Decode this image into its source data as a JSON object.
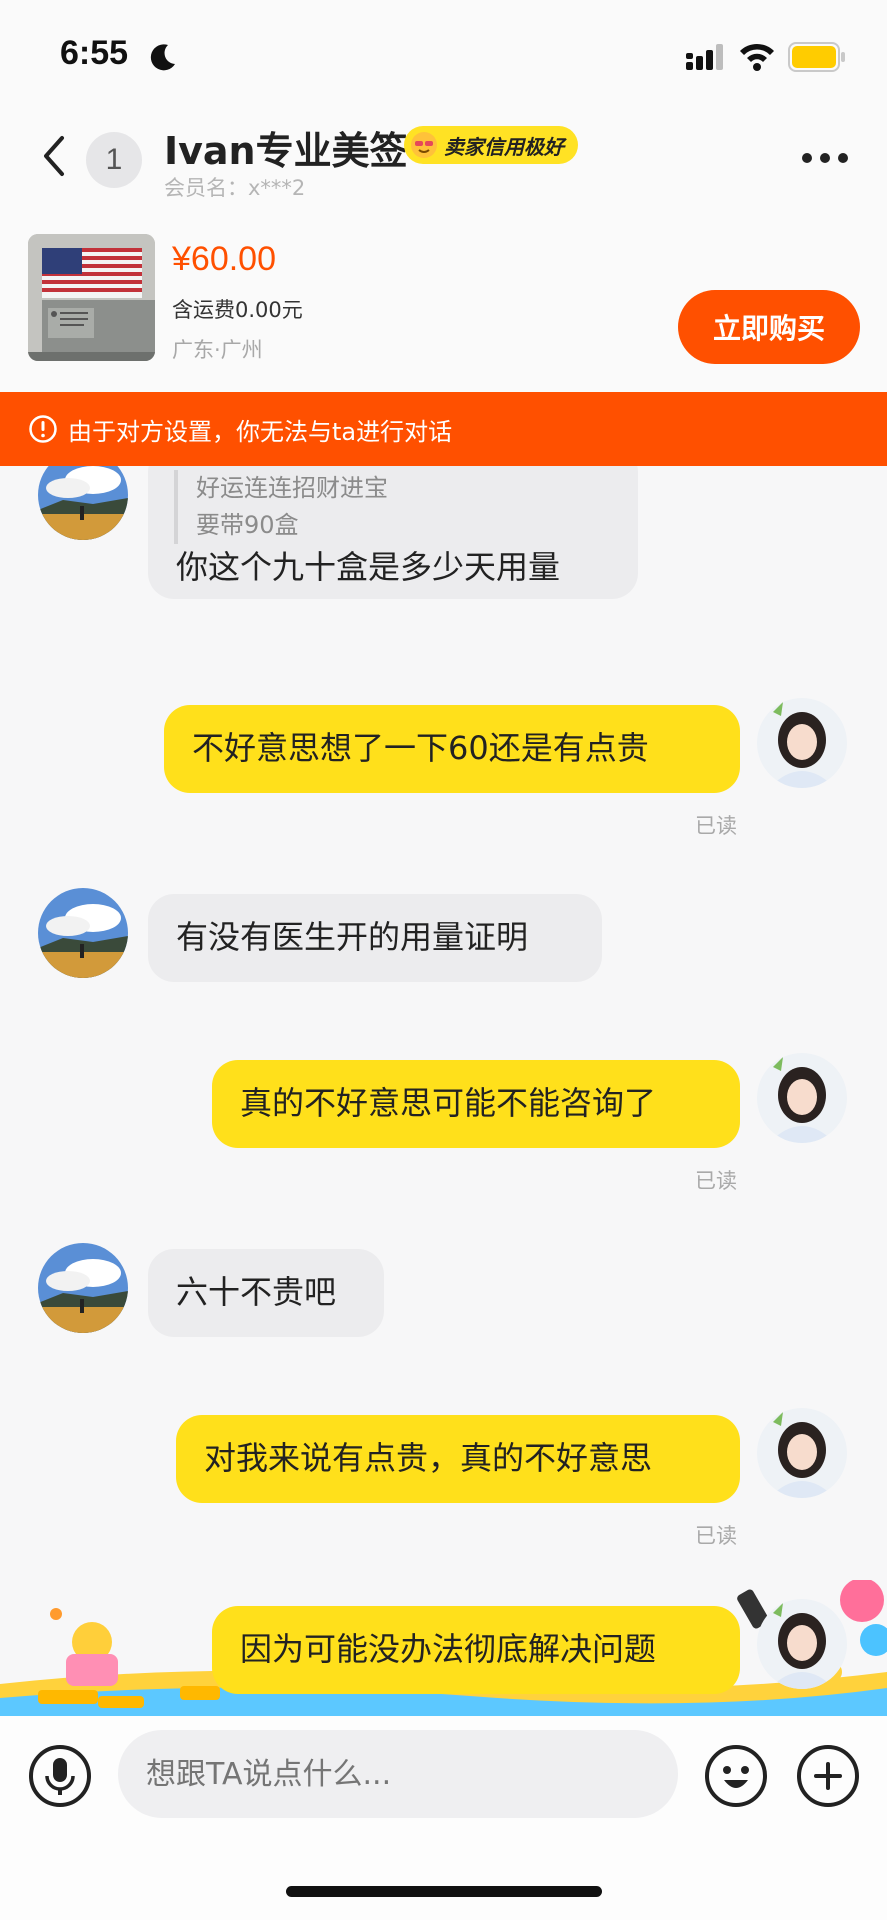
{
  "status_bar": {
    "time": "6:55"
  },
  "header": {
    "unread_count": "1",
    "contact_name": "Ivan专业美签",
    "seller_badge": "卖家信用极好",
    "member_id": "会员名：x***2"
  },
  "product": {
    "price": "¥60.00",
    "shipping": "含运费0.00元",
    "location": "广东·广州",
    "buy_label": "立即购买"
  },
  "warning": {
    "text": "由于对方设置，你无法与ta进行对话"
  },
  "messages": [
    {
      "from": "other",
      "quote": [
        "好运连连招财进宝",
        "要带90盒"
      ],
      "text": "你这个九十盒是多少天用量"
    },
    {
      "from": "me",
      "text": "不好意思想了一下60还是有点贵",
      "status": "已读"
    },
    {
      "from": "other",
      "text": "有没有医生开的用量证明"
    },
    {
      "from": "me",
      "text": "真的不好意思可能不能咨询了",
      "status": "已读"
    },
    {
      "from": "other",
      "text": "六十不贵吧"
    },
    {
      "from": "me",
      "text": "对我来说有点贵，真的不好意思",
      "status": "已读"
    },
    {
      "from": "me",
      "text": "因为可能没办法彻底解决问题"
    }
  ],
  "input": {
    "placeholder": "想跟TA说点什么..."
  },
  "colors": {
    "accent": "#ff5000",
    "my_bubble": "#ffe01b",
    "their_bubble": "#ececee"
  }
}
